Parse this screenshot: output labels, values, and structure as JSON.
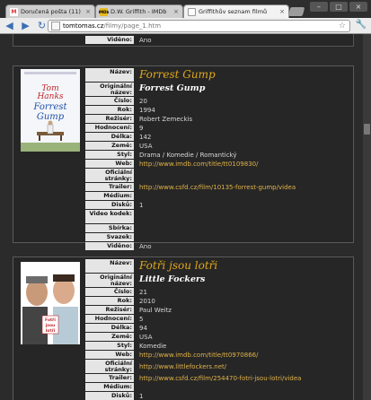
{
  "browser": {
    "tabs": [
      {
        "label": "Doručená pošta (11)",
        "icon": "gmail-icon"
      },
      {
        "label": "D.W. Griffith - IMDb",
        "icon": "imdb-icon"
      },
      {
        "label": "Griffithův seznam filmů",
        "icon": "page-icon",
        "active": true
      }
    ],
    "url_host": "tomtomas.cz",
    "url_path": "/filmy/page_1.htm"
  },
  "top_row": {
    "label": "Viděno:",
    "value": "Ano"
  },
  "movies": [
    {
      "poster": {
        "line1": "Tom",
        "line2": "Hanks",
        "line3": "Forrest",
        "line4": "Gump"
      },
      "rows": [
        {
          "label": "Název:",
          "value": "Forrest Gump"
        },
        {
          "label": "Originální název:",
          "value": "Forrest Gump"
        },
        {
          "label": "Číslo:",
          "value": "20"
        },
        {
          "label": "Rok:",
          "value": "1994"
        },
        {
          "label": "Režisér:",
          "value": "Robert Zemeckis"
        },
        {
          "label": "Hodnocení:",
          "value": "9"
        },
        {
          "label": "Délka:",
          "value": "142"
        },
        {
          "label": "Země:",
          "value": "USA"
        },
        {
          "label": "Styl:",
          "value": "Drama / Komedie / Romantický"
        },
        {
          "label": "Web:",
          "value": "http://www.imdb.com/title/tt0109830/"
        },
        {
          "label": "Oficiální stránky:",
          "value": ""
        },
        {
          "label": "Trailer:",
          "value": "http://www.csfd.cz/film/10135-forrest-gump/videa"
        },
        {
          "label": "Médium:",
          "value": ""
        },
        {
          "label": "Disků:",
          "value": "1"
        },
        {
          "label": "Video kodek:",
          "value": ""
        },
        {
          "label": "Sbírka:",
          "value": ""
        },
        {
          "label": "Svazek:",
          "value": ""
        },
        {
          "label": "Viděno:",
          "value": "Ano"
        }
      ]
    },
    {
      "poster": {
        "line1": "Fotři",
        "line2": "jsou",
        "line3": "lotři",
        "line4": ""
      },
      "rows": [
        {
          "label": "Název:",
          "value": "Fotři jsou lotři"
        },
        {
          "label": "Originální název:",
          "value": "Little Fockers"
        },
        {
          "label": "Číslo:",
          "value": "21"
        },
        {
          "label": "Rok:",
          "value": "2010"
        },
        {
          "label": "Režisér:",
          "value": "Paul Weitz"
        },
        {
          "label": "Hodnocení:",
          "value": "5"
        },
        {
          "label": "Délka:",
          "value": "94"
        },
        {
          "label": "Země:",
          "value": "USA"
        },
        {
          "label": "Styl:",
          "value": "Komedie"
        },
        {
          "label": "Web:",
          "value": "http://www.imdb.com/title/tt0970866/"
        },
        {
          "label": "Oficiální stránky:",
          "value": "http://www.littlefockers.net/"
        },
        {
          "label": "Trailer:",
          "value": "http://www.csfd.cz/film/254470-fotri-jsou-lotri/videa"
        },
        {
          "label": "Médium:",
          "value": ""
        },
        {
          "label": "Disků:",
          "value": "1"
        }
      ]
    }
  ]
}
